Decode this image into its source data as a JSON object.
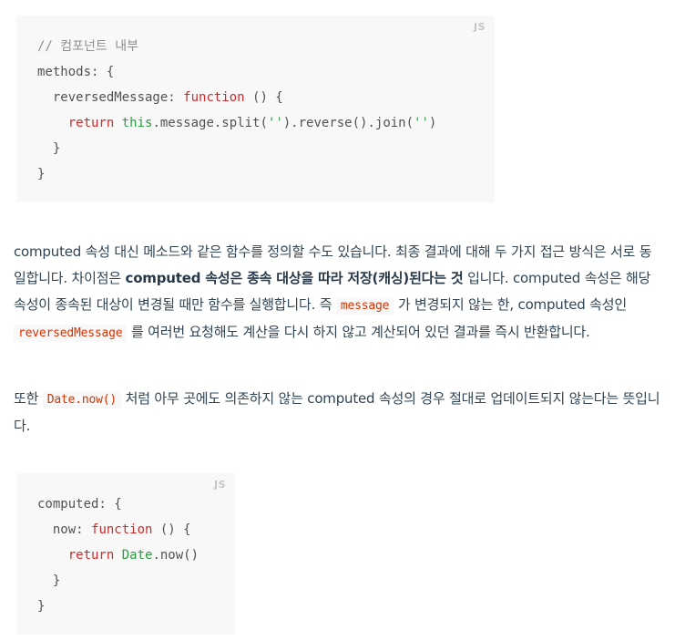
{
  "code_block_1": {
    "lang": "JS",
    "lines": {
      "l1": "// 컴포넌트 내부",
      "l2": "methods: {",
      "l3_a": "  reversedMessage: ",
      "l3_kw": "function",
      "l3_b": " () {",
      "l4_kw": "return",
      "l4_this": "this",
      "l4_a": ".message.split(",
      "l4_s1": "''",
      "l4_b": ").reverse().join(",
      "l4_s2": "''",
      "l4_c": ")",
      "l5": "  }",
      "l6": "}"
    }
  },
  "paragraph_1": {
    "t1": "computed 속성 대신 메소드와 같은 함수를 정의할 수도 있습니다. 최종 결과에 대해 두 가지 접근 방식은 서로 동일합니다. 차이점은 ",
    "b1": "computed 속성은 종속 대상을 따라 저장(캐싱)된다는 것",
    "t2": " 입니다. computed 속성은 해당 속성이 종속된 대상이 변경될 때만 함수를 실행합니다. 즉 ",
    "c1": "message",
    "t3": " 가 변경되지 않는 한, computed 속성인 ",
    "c2": "reversedMessage",
    "t4": " 를 여러번 요청해도 계산을 다시 하지 않고 계산되어 있던 결과를 즉시 반환합니다."
  },
  "paragraph_2": {
    "t1": "또한 ",
    "c1": "Date.now()",
    "t2": " 처럼 아무 곳에도 의존하지 않는 computed 속성의 경우 절대로 업데이트되지 않는다는 뜻입니다."
  },
  "code_block_2": {
    "lang": "JS",
    "lines": {
      "l1": "computed: {",
      "l2_a": "  now: ",
      "l2_kw": "function",
      "l2_b": " () {",
      "l3_kw": "return",
      "l3_date": "Date",
      "l3_a": ".now()",
      "l4": "  }",
      "l5": "}"
    }
  }
}
